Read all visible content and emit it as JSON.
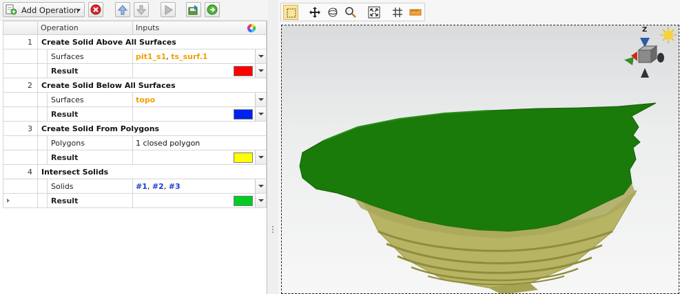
{
  "toolbar": {
    "add_operation_label": "Add Operation"
  },
  "grid": {
    "columns": {
      "operation": "Operation",
      "inputs": "Inputs"
    },
    "operations": [
      {
        "number": "1",
        "name": "Create Solid Above All Surfaces",
        "input_label": "Surfaces",
        "input_parts": [
          "pit1_s1",
          ", ",
          "ts_surf.1"
        ],
        "result_label": "Result",
        "result_color": "#ff0000"
      },
      {
        "number": "2",
        "name": "Create Solid Below All Surfaces",
        "input_label": "Surfaces",
        "input_parts": [
          "topo"
        ],
        "result_label": "Result",
        "result_color": "#0022ee"
      },
      {
        "number": "3",
        "name": "Create Solid From Polygons",
        "input_label": "Polygons",
        "input_parts": [
          "1 closed polygon"
        ],
        "result_label": "Result",
        "result_color": "#ffff00"
      },
      {
        "number": "4",
        "name": "Intersect Solids",
        "input_label": "Solids",
        "input_parts": [
          "#1",
          ", ",
          "#2",
          ", ",
          "#3"
        ],
        "result_label": "Result",
        "result_color": "#00cc22"
      }
    ]
  },
  "viewer": {
    "gizmo_axis_label": "Z",
    "colors": {
      "terrain_top": "#1a7a0a",
      "pit_solid": "#b7b463",
      "pit_bands": "#8f8c3c"
    }
  }
}
